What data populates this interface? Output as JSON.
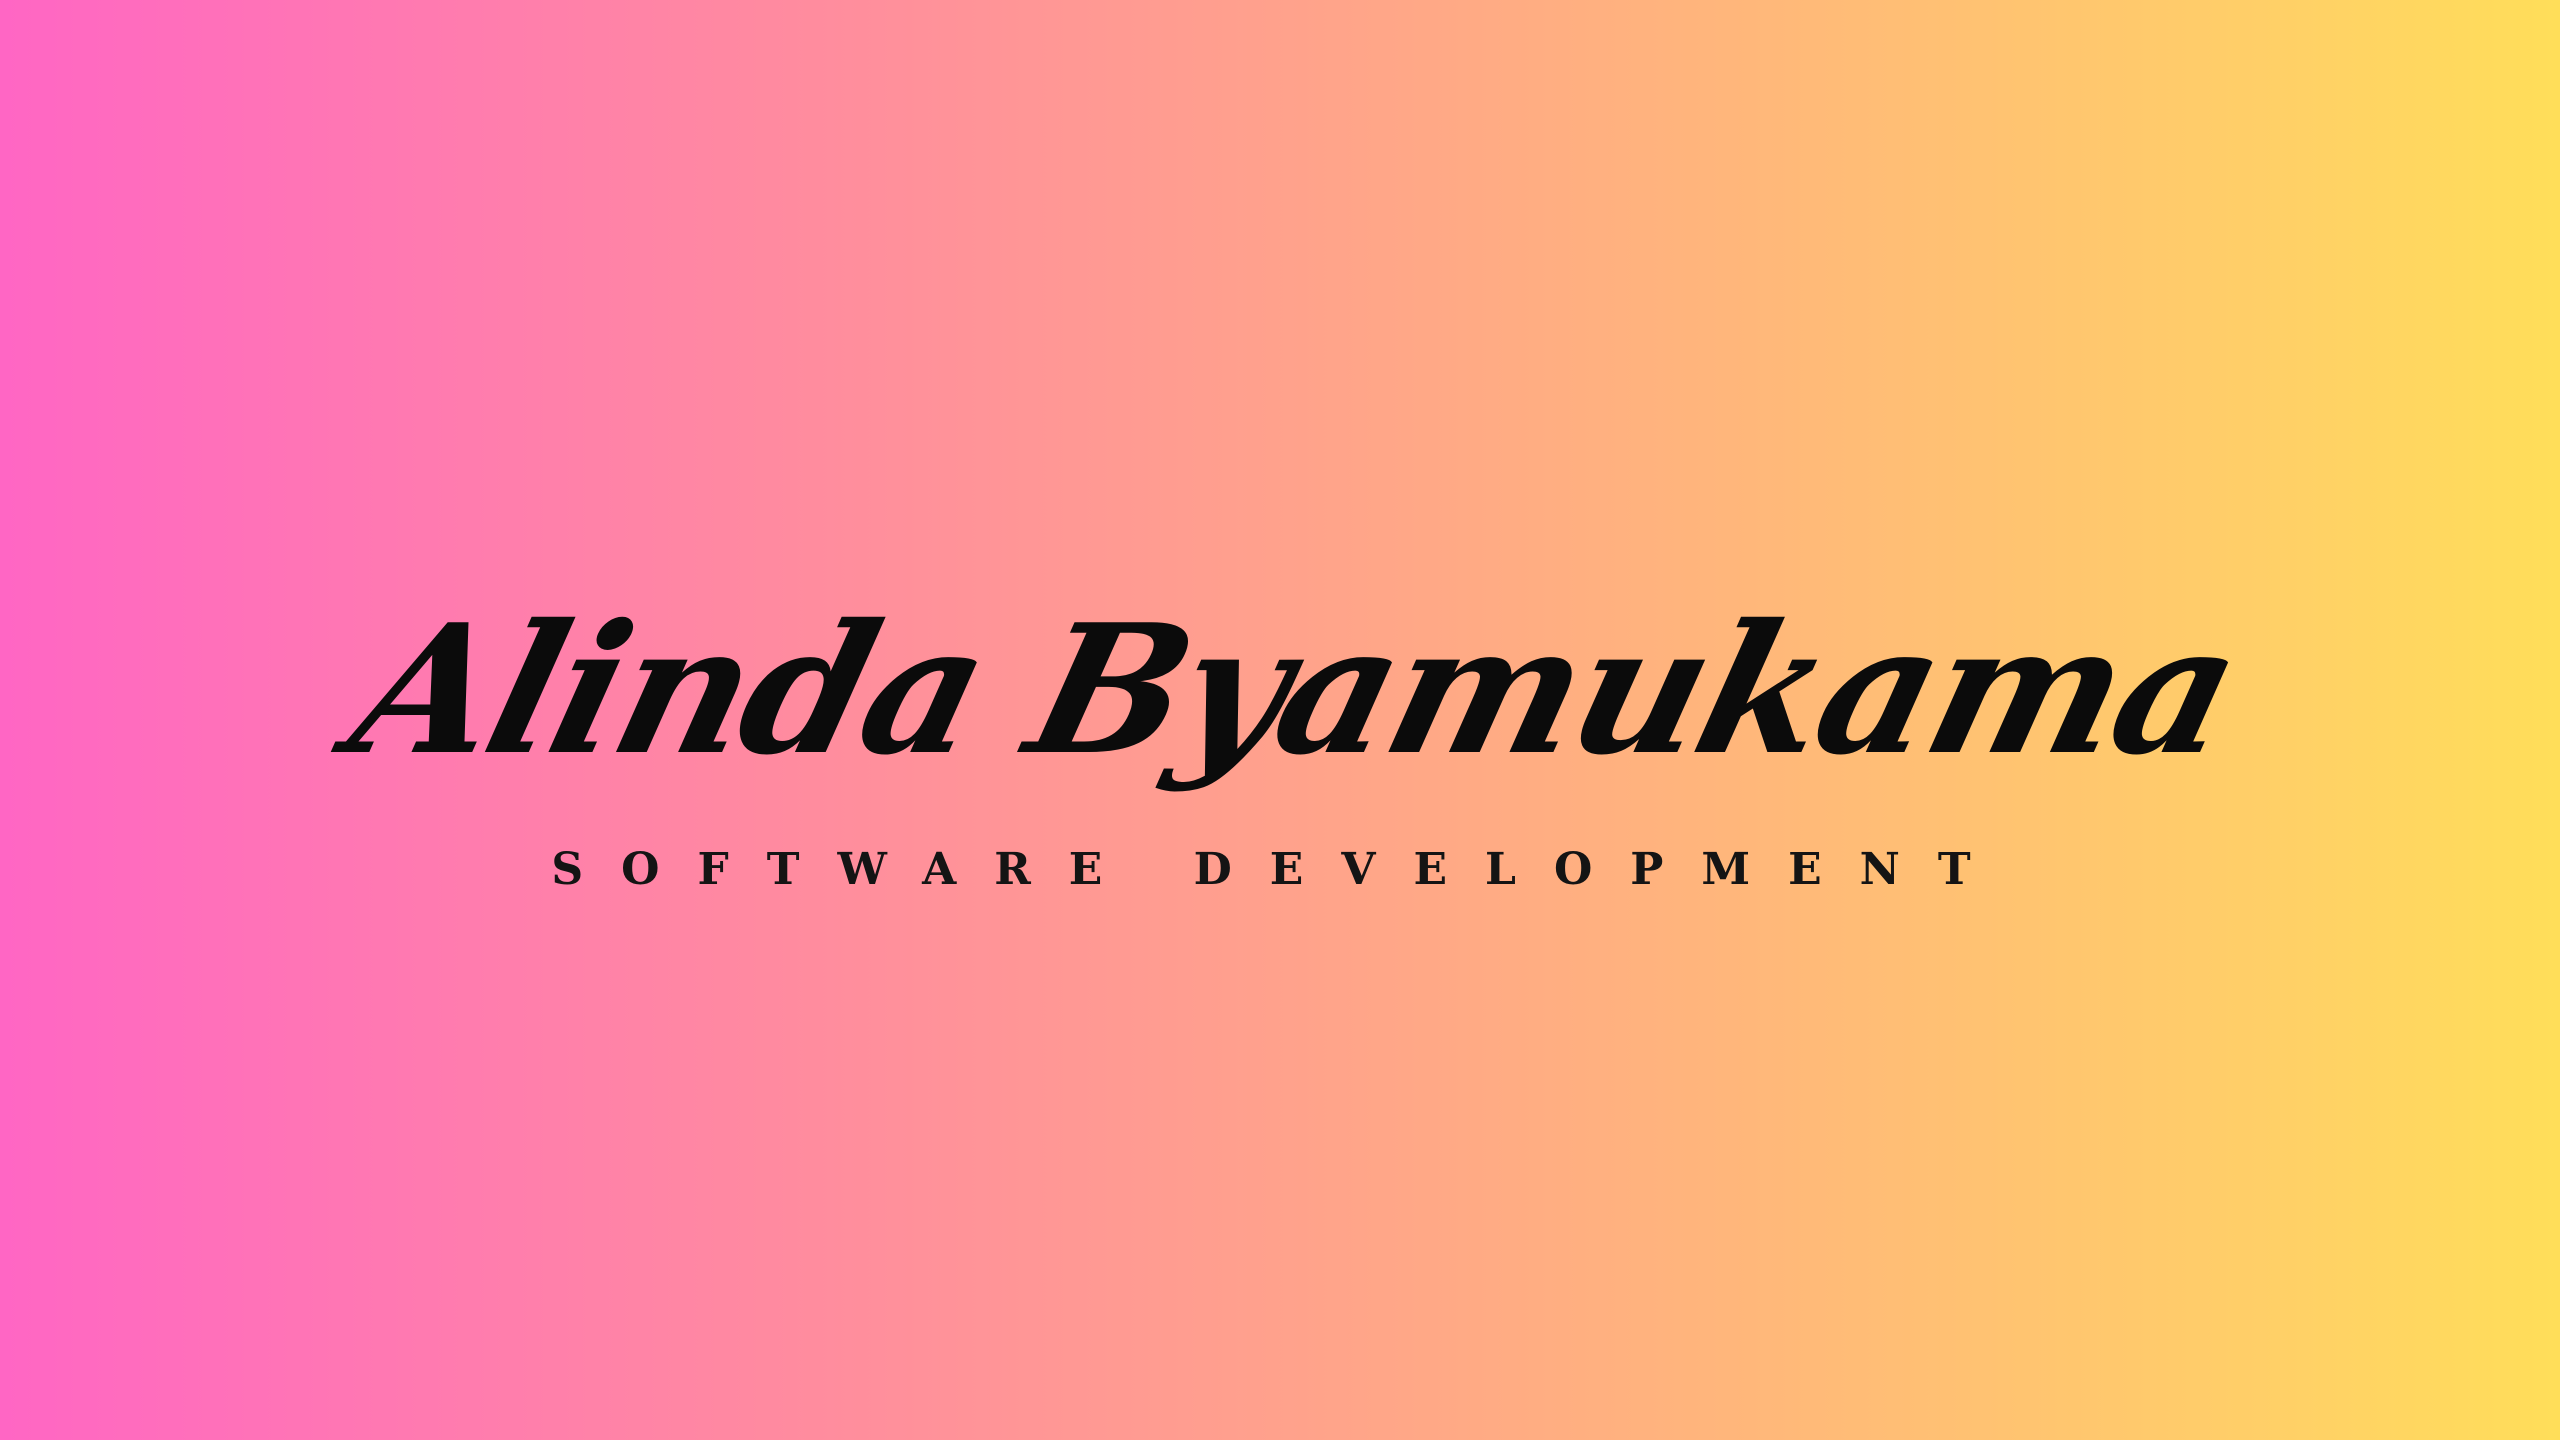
{
  "brand": {
    "name": "Alinda Byamukama",
    "tagline": "SOFTWARE DEVELOPMENT"
  },
  "colors": {
    "gradient_start": "#ff66c4",
    "gradient_end": "#ffde59",
    "text": "#0b0b0b"
  }
}
